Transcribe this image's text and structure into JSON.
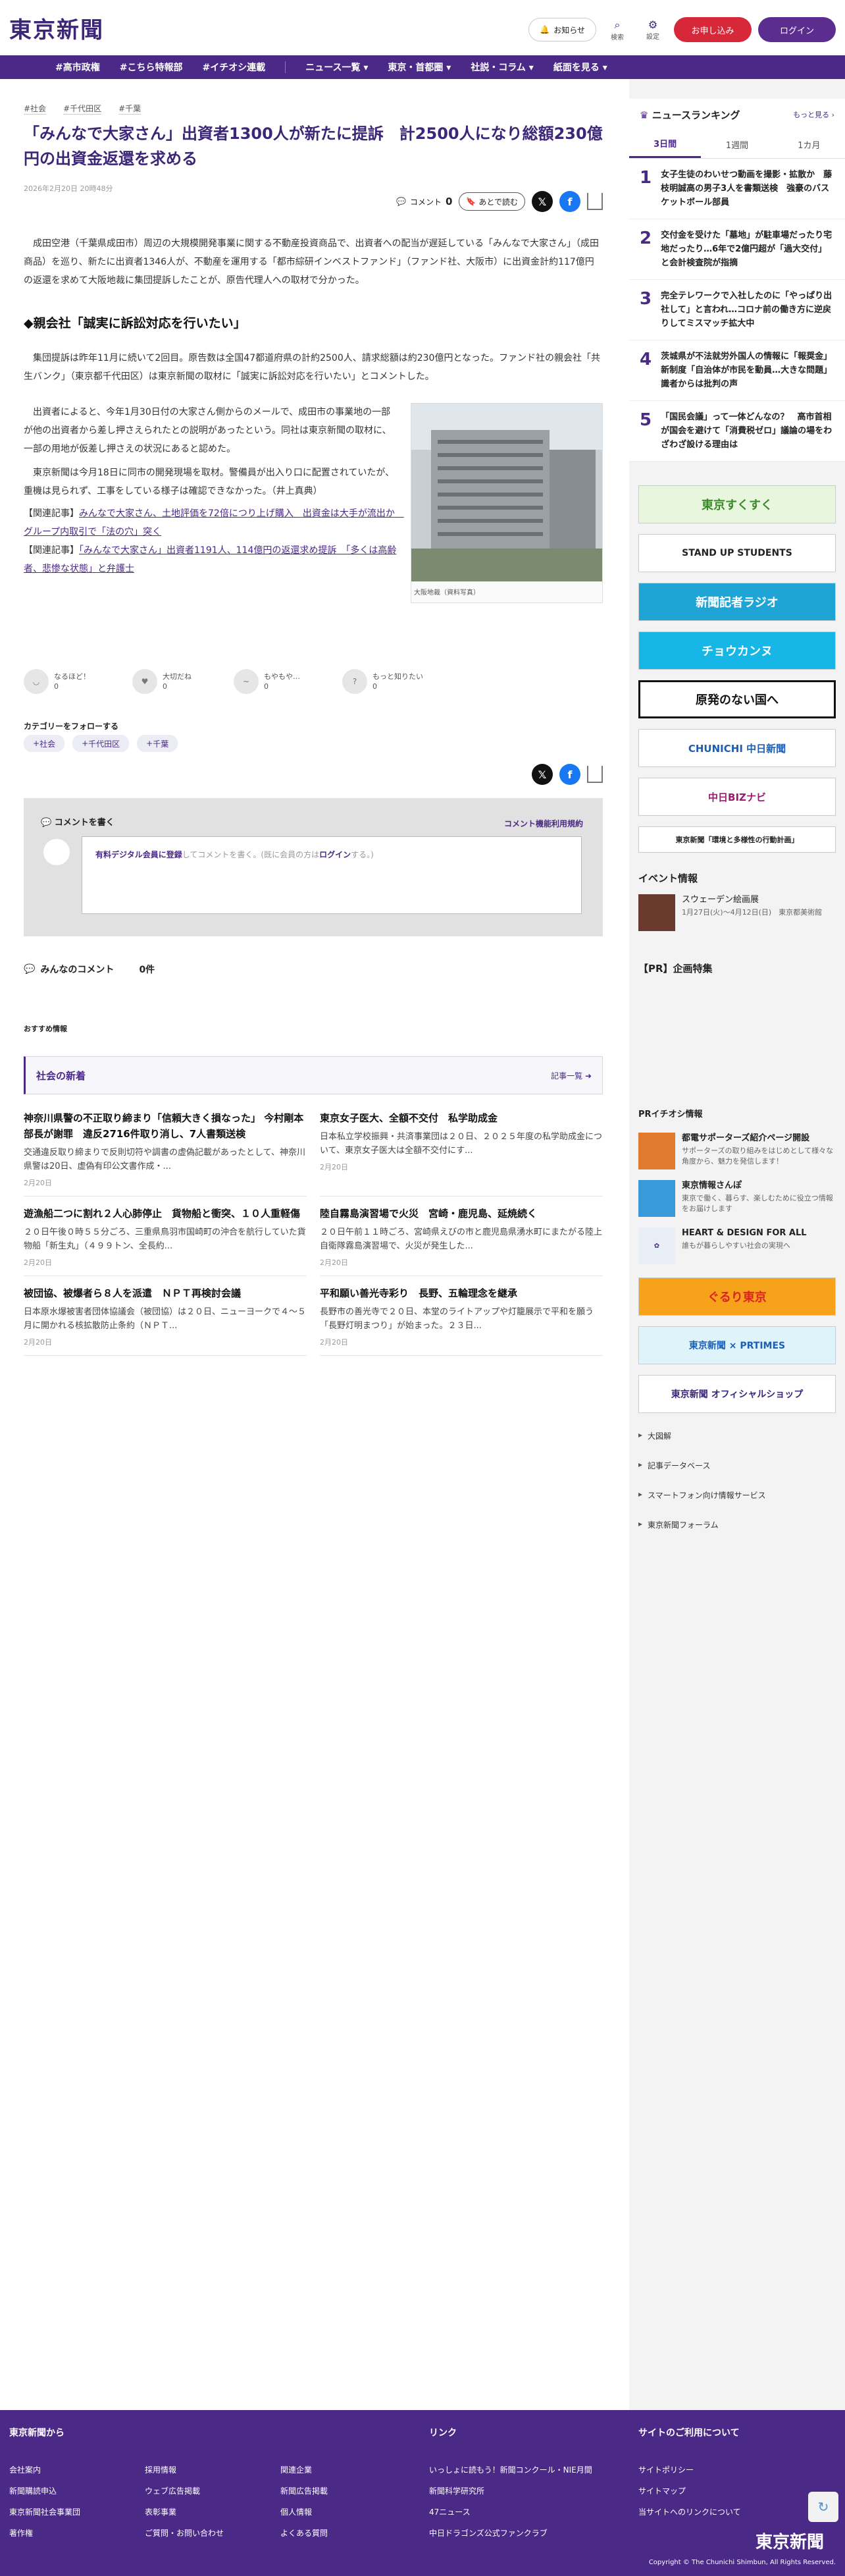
{
  "header": {
    "logo": "東京新聞",
    "notice": "お知らせ",
    "search": "検索",
    "settings": "設定",
    "apply": "お申し込み",
    "login": "ログイン"
  },
  "nav": [
    "#高市政権",
    "#こちら特報部",
    "#イチオシ連載",
    "ニュース一覧",
    "東京・首都圏",
    "社説・コラム",
    "紙面を見る"
  ],
  "article": {
    "tags": [
      "#社会",
      "#千代田区",
      "#千葉"
    ],
    "title": "「みんなで大家さん」出資者1300人が新たに提訴　計2500人になり総額230億円の出資金返還を求める",
    "date": "2026年2月20日 20時48分",
    "comment_label": "コメント",
    "comment_count": "0",
    "later": "あとで読む",
    "p1": "成田空港（千葉県成田市）周辺の大規模開発事業に関する不動産投資商品で、出資者への配当が遅延している「みんなで大家さん」（成田商品）を巡り、新たに出資者1346人が、不動産を運用する「都市綜研インベストファンド」（ファンド社、大阪市）に出資金計約117億円の返還を求めて大阪地裁に集団提訴したことが、原告代理人への取材で分かった。",
    "h2": "◆親会社「誠実に訴訟対応を行いたい」",
    "p2": "集団提訴は昨年11月に続いて2回目。原告数は全国47都道府県の計約2500人、請求総額は約230億円となった。ファンド社の親会社「共生バンク」（東京都千代田区）は東京新聞の取材に「誠実に訴訟対応を行いたい」とコメントした。",
    "p3": "出資者によると、今年1月30日付の大家さん側からのメールで、成田市の事業地の一部が他の出資者から差し押さえられたとの説明があったという。同社は東京新聞の取材に、一部の用地が仮差し押さえの状況にあると認めた。",
    "p4": "東京新聞は今月18日に同市の開発現場を取材。警備員が出入り口に配置されていたが、重機は見られず、工事をしている様子は確認できなかった。（井上真典）",
    "rel_label": "【関連記事】",
    "rel1": "みんなで大家さん、土地評価を72倍につり上げ購入　出資金は大手が流出か　グループ内取引で「法の穴」突く",
    "rel2": "「みんなで大家さん」出資者1191人、114億円の返還求め提訴　「多くは高齢者、悲惨な状態」と弁護士",
    "photo_caption": "大阪地裁（資料写真）",
    "reactions": [
      {
        "label": "なるほど！",
        "count": "0"
      },
      {
        "label": "大切だね",
        "count": "0"
      },
      {
        "label": "もやもや…",
        "count": "0"
      },
      {
        "label": "もっと知りたい",
        "count": "0"
      }
    ],
    "follow_title": "カテゴリーをフォローする",
    "follow_tags": [
      "社会",
      "千代田区",
      "千葉"
    ]
  },
  "comment_box": {
    "title": "コメントを書く",
    "rules": "コメント機能利用規約",
    "text1": "有料デジタル会員に登録",
    "text2": "してコメントを書く。(既に会員の方は",
    "text3": "ログイン",
    "text4": "する。)"
  },
  "all_comments": {
    "title": "みんなのコメント",
    "count": "0件"
  },
  "recommend": "おすすめ情報",
  "social": {
    "title": "社会の新着",
    "more": "記事一覧",
    "items": [
      {
        "title": "神奈川県警の不正取り締まり「信頼大きく損なった」 今村剛本部長が謝罪　違反2716件取り消し、7人書類送検",
        "text": "交通違反取り締まりで反則切符や調書の虚偽記載があったとして、神奈川県警は20日、虚偽有印公文書作成・...",
        "date": "2月20日"
      },
      {
        "title": "東京女子医大、全額不交付　私学助成金",
        "text": "日本私立学校振興・共済事業団は２０日、２０２５年度の私学助成金について、東京女子医大は全額不交付にす...",
        "date": "2月20日"
      },
      {
        "title": "遊漁船二つに割れ２人心肺停止　貨物船と衝突、１０人重軽傷",
        "text": "２０日午後０時５５分ごろ、三重県鳥羽市国崎町の沖合を航行していた貨物船「新生丸」（４９９トン、全長約...",
        "date": "2月20日"
      },
      {
        "title": "陸自霧島演習場で火災　宮崎・鹿児島、延焼続く",
        "text": "２０日午前１１時ごろ、宮崎県えびの市と鹿児島県湧水町にまたがる陸上自衛隊霧島演習場で、火災が発生した...",
        "date": "2月20日"
      },
      {
        "title": "被団協、被爆者ら８人を派遣　ＮＰＴ再検討会議",
        "text": "日本原水爆被害者団体協議会（被団協）は２０日、ニューヨークで４〜５月に開かれる核拡散防止条約（ＮＰＴ...",
        "date": "2月20日"
      },
      {
        "title": "平和願い善光寺彩り　長野、五輪理念を継承",
        "text": "長野市の善光寺で２０日、本堂のライトアップや灯籠展示で平和を願う「長野灯明まつり」が始まった。２３日...",
        "date": "2月20日"
      }
    ]
  },
  "ranking": {
    "title": "ニュースランキング",
    "more": "もっと見る",
    "tabs": [
      "3日間",
      "1週間",
      "1カ月"
    ],
    "items": [
      {
        "n": "1",
        "t": "女子生徒のわいせつ動画を撮影・拡散か　藤枝明誠高の男子3人を書類送検　強豪のバスケットボール部員"
      },
      {
        "n": "2",
        "t": "交付金を受けた「墓地」が駐車場だったり宅地だったり…6年で2億円超が「過大交付」と会計検査院が指摘"
      },
      {
        "n": "3",
        "t": "完全テレワークで入社したのに「やっぱり出社して」と言われ…コロナ前の働き方に逆戻りしてミスマッチ拡大中"
      },
      {
        "n": "4",
        "t": "茨城県が不法就労外国人の情報に「報奨金」新制度「自治体が市民を動員…大きな問題」識者からは批判の声"
      },
      {
        "n": "5",
        "t": "「国民会議」って一体どんなの？　高市首相が国会を避けて「消費税ゼロ」議論の場をわざわざ設ける理由は"
      }
    ]
  },
  "banners": [
    "東京すくすく",
    "STAND UP STUDENTS",
    "新聞記者ラジオ",
    "チョウカンヌ",
    "原発のない国へ",
    "CHUNICHI 中日新聞",
    "中日BIZナビ",
    "東京新聞「環境と多様性の行動計画」"
  ],
  "events": {
    "title": "イベント情報",
    "name": "スウェーデン絵画展",
    "desc": "1月27日(火)〜4月12日(日)　東京都美術館"
  },
  "pr_title": "【PR】企画特集",
  "pr_events": {
    "title": "PRイチオシ情報",
    "items": [
      {
        "t": "都電サポーターズ紹介ページ開設",
        "s": "サポーターズの取り組みをはじめとして様々な角度から、魅力を発信します！"
      },
      {
        "t": "東京情報さんぽ",
        "s": "東京で働く、暮らす、楽しむために役立つ情報をお届けします"
      },
      {
        "t": "HEART & DESIGN FOR ALL",
        "s": "誰もが暮らしやすい社会の実現へ"
      }
    ]
  },
  "banners2": [
    "ぐるり東京",
    "東京新聞 × PRTIMES",
    "東京新聞 オフィシャルショップ"
  ],
  "side_links": [
    "大図解",
    "記事データベース",
    "スマートフォン向け情報サービス",
    "東京新聞フォーラム"
  ],
  "footer": {
    "col1": "東京新聞から",
    "col2": "リンク",
    "col3": "サイトのご利用について",
    "links1": [
      "会社案内",
      "採用情報",
      "関連企業",
      "新聞購読申込",
      "ウェブ広告掲載",
      "新聞広告掲載",
      "東京新聞社会事業団",
      "表彰事業",
      "個人情報",
      "著作権",
      "ご質問・お問い合わせ",
      "よくある質問"
    ],
    "links2": [
      "いっしょに読もう！新聞コンクール・NIE月間",
      "新聞科学研究所",
      "47ニュース",
      "中日ドラゴンズ公式ファンクラブ"
    ],
    "links3": [
      "サイトポリシー",
      "サイトマップ",
      "当サイトへのリンクについて"
    ],
    "logo": "東京新聞",
    "copy": "Copyright © The Chunichi Shimbun, All Rights Reserved."
  }
}
